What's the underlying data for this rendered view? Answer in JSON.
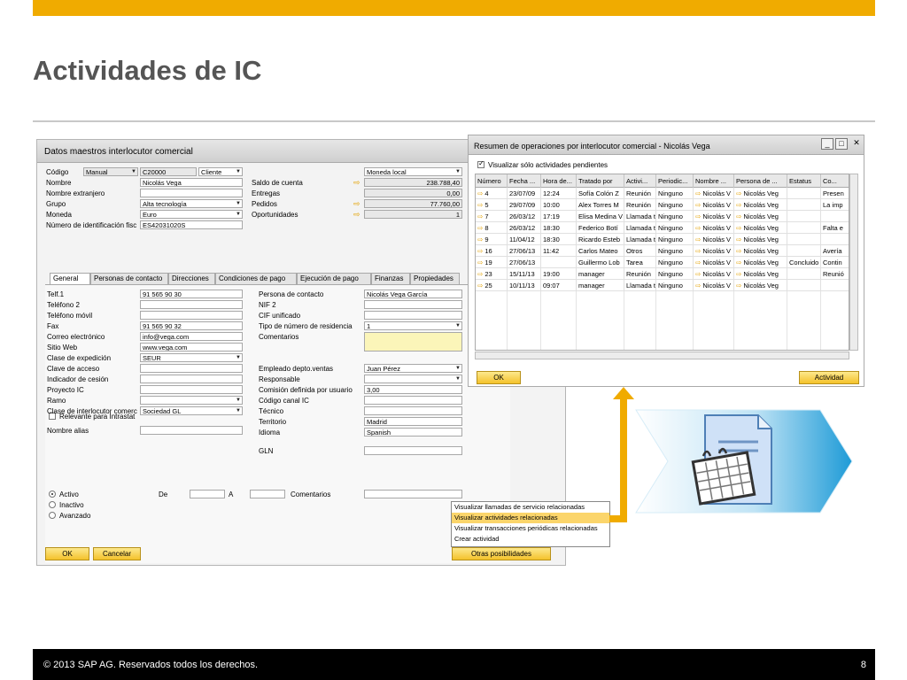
{
  "slide": {
    "title": "Actividades de IC",
    "footer_text": "© 2013 SAP AG. Reservados todos los derechos.",
    "page_number": "8"
  },
  "bp_window": {
    "title": "Datos maestros interlocutor comercial",
    "header_left": [
      {
        "label": "Código",
        "value1": "Manual",
        "value2": "C20000",
        "value3": "Cliente"
      },
      {
        "label": "Nombre",
        "value": "Nicolás Vega"
      },
      {
        "label": "Nombre extranjero",
        "value": ""
      },
      {
        "label": "Grupo",
        "value": "Alta tecnología"
      },
      {
        "label": "Moneda",
        "value": "Euro"
      },
      {
        "label": "Número de identificación fisc",
        "value": "ES42031020S"
      }
    ],
    "header_right": {
      "currency_select": "Moneda local",
      "rows": [
        {
          "label": "Saldo de cuenta",
          "value": "238.788,40"
        },
        {
          "label": "Entregas",
          "value": "0,00"
        },
        {
          "label": "Pedidos",
          "value": "77.760,00"
        },
        {
          "label": "Oportunidades",
          "value": "1"
        }
      ]
    },
    "tabs": [
      "General",
      "Personas de contacto",
      "Direcciones",
      "Condiciones de pago",
      "Ejecución de pago",
      "Finanzas",
      "Propiedades"
    ],
    "general_left": [
      {
        "label": "Telf.1",
        "value": "91 565 90 30"
      },
      {
        "label": "Teléfono 2",
        "value": ""
      },
      {
        "label": "Teléfono móvil",
        "value": ""
      },
      {
        "label": "Fax",
        "value": "91 565 90 32"
      },
      {
        "label": "Correo electrónico",
        "value": "info@vega.com"
      },
      {
        "label": "Sitio Web",
        "value": "www.vega.com"
      },
      {
        "label": "Clase de expedición",
        "value": "SEUR"
      },
      {
        "label": "Clave de acceso",
        "value": ""
      },
      {
        "label": "Indicador de cesión",
        "value": ""
      },
      {
        "label": "Proyecto IC",
        "value": ""
      },
      {
        "label": "Ramo",
        "value": ""
      },
      {
        "label": "Clase de interlocutor comerc",
        "value": "Sociedad GL"
      }
    ],
    "general_right": [
      {
        "label": "Persona de contacto",
        "value": "Nicolás Vega García"
      },
      {
        "label": "NIF 2",
        "value": ""
      },
      {
        "label": "CIF unificado",
        "value": ""
      },
      {
        "label": "Tipo de número de residencia",
        "value": "1"
      },
      {
        "label": "Comentarios",
        "value": ""
      },
      {
        "label": "Empleado depto.ventas",
        "value": "Juan Pérez"
      },
      {
        "label": "Responsable",
        "value": ""
      },
      {
        "label": "Comisión definida por usuario",
        "value": "3,00"
      },
      {
        "label": "Código canal IC",
        "value": ""
      },
      {
        "label": "Técnico",
        "value": ""
      },
      {
        "label": "Territorio",
        "value": "Madrid"
      },
      {
        "label": "Idioma",
        "value": "Spanish"
      }
    ],
    "intrastat_label": "Relevante para Intrastat",
    "alias_label": "Nombre alias",
    "gln_label": "GLN",
    "radios": [
      "Activo",
      "Inactivo",
      "Avanzado"
    ],
    "de_label": "De",
    "a_label": "A",
    "comentarios_label": "Comentarios",
    "ok_label": "OK",
    "cancel_label": "Cancelar",
    "more_label": "Otras posibilidades"
  },
  "context_menu": {
    "items": [
      "Visualizar llamadas de servicio relacionadas",
      "Visualizar actividades relacionadas",
      "Visualizar transacciones periódicas relacionadas",
      "Crear actividad"
    ],
    "highlighted_index": 1
  },
  "summary_window": {
    "title": "Resumen de operaciones por interlocutor comercial - Nicolás Vega",
    "checkbox_label": "Visualizar sólo actividades pendientes",
    "columns": [
      "Número",
      "Fecha ...",
      "Hora de...",
      "Tratado por",
      "Activi...",
      "Periodic...",
      "Nombre ...",
      "Persona de ...",
      "Estatus",
      "Co..."
    ],
    "rows": [
      [
        "4",
        "23/07/09",
        "12:24",
        "Sofía Colón Z",
        "Reunión",
        "Ninguno",
        "Nicolás V",
        "Nicolás Veg",
        "",
        "Presen"
      ],
      [
        "5",
        "29/07/09",
        "10:00",
        "Alex Torres M",
        "Reunión",
        "Ninguno",
        "Nicolás V",
        "Nicolás Veg",
        "",
        "La imp"
      ],
      [
        "7",
        "26/03/12",
        "17:19",
        "Elisa Medina V",
        "Llamada t",
        "Ninguno",
        "Nicolás V",
        "Nicolás Veg",
        "",
        ""
      ],
      [
        "8",
        "26/03/12",
        "18:30",
        "Federico Botí",
        "Llamada t",
        "Ninguno",
        "Nicolás V",
        "Nicolás Veg",
        "",
        "Falta e"
      ],
      [
        "9",
        "11/04/12",
        "18:30",
        "Ricardo Esteb",
        "Llamada t",
        "Ninguno",
        "Nicolás V",
        "Nicolás Veg",
        "",
        ""
      ],
      [
        "16",
        "27/06/13",
        "11:42",
        "Carlos Mateo",
        "Otros",
        "Ninguno",
        "Nicolás V",
        "Nicolás Veg",
        "",
        "Avería"
      ],
      [
        "19",
        "27/06/13",
        "",
        "Guillermo Lob",
        "Tarea",
        "Ninguno",
        "Nicolás V",
        "Nicolás Veg",
        "Concluido",
        "Contin"
      ],
      [
        "23",
        "15/11/13",
        "19:00",
        "manager",
        "Reunión",
        "Ninguno",
        "Nicolás V",
        "Nicolás Veg",
        "",
        "Reunió"
      ],
      [
        "25",
        "10/11/13",
        "09:07",
        "manager",
        "Llamada t",
        "Ninguno",
        "Nicolás V",
        "Nicolás Veg",
        "",
        ""
      ]
    ],
    "ok_label": "OK",
    "activity_label": "Actividad"
  },
  "colors": {
    "accent": "#f0ab00",
    "graphic_blue": "#1e9bd7"
  },
  "icons": [
    "document-calendar-icon"
  ]
}
